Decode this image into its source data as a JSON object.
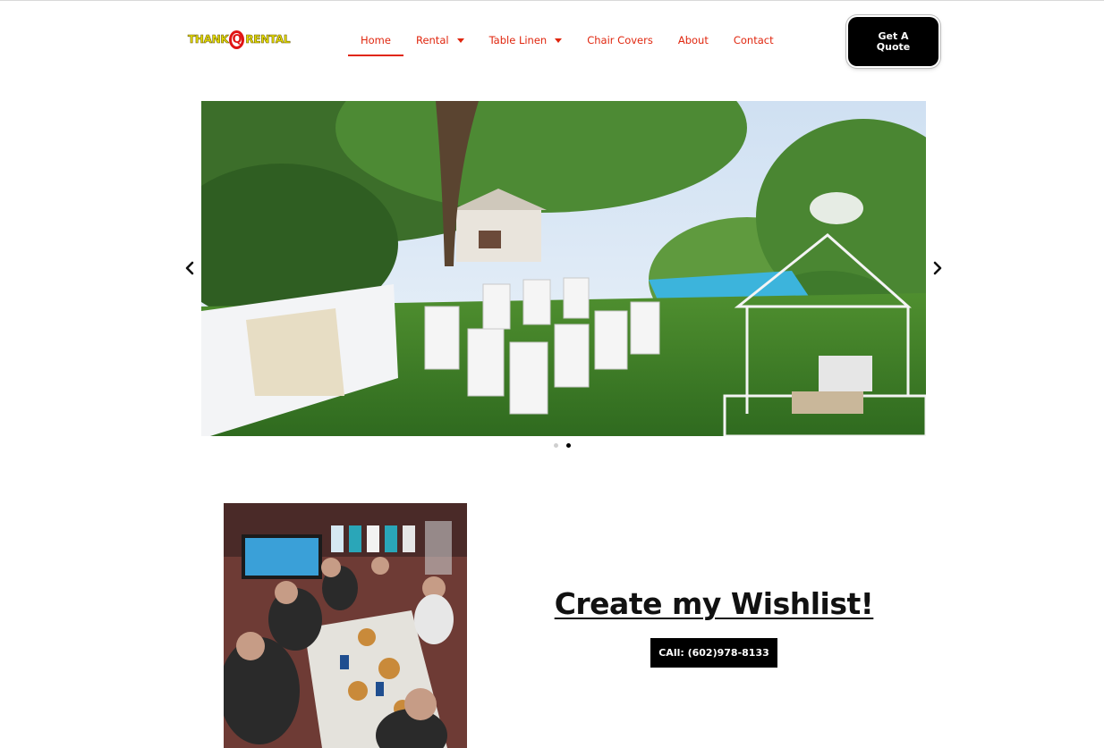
{
  "header": {
    "logo": {
      "part1": "THANK",
      "q": "Q",
      "part2": "RENTAL"
    },
    "nav": [
      {
        "label": "Home",
        "active": true
      },
      {
        "label": "Rental",
        "dropdown": true
      },
      {
        "label": "Table Linen",
        "dropdown": true
      },
      {
        "label": "Chair Covers"
      },
      {
        "label": "About"
      },
      {
        "label": "Contact"
      }
    ],
    "quote_button": "Get A Quote"
  },
  "slider": {
    "slides": [
      {
        "image": "backyard-event-tables-white-chairs"
      },
      {
        "image": "second-slide"
      }
    ],
    "active_index": 1,
    "prev_icon": "chevron-left-icon",
    "next_icon": "chevron-right-icon"
  },
  "wishlist": {
    "photo": "family-dinner-photo",
    "title": "Create my Wishlist!",
    "call_button": "CAll: (602)978-8133"
  },
  "colors": {
    "accent": "#e0260e",
    "button_bg": "#000000",
    "button_text": "#ffffff"
  }
}
